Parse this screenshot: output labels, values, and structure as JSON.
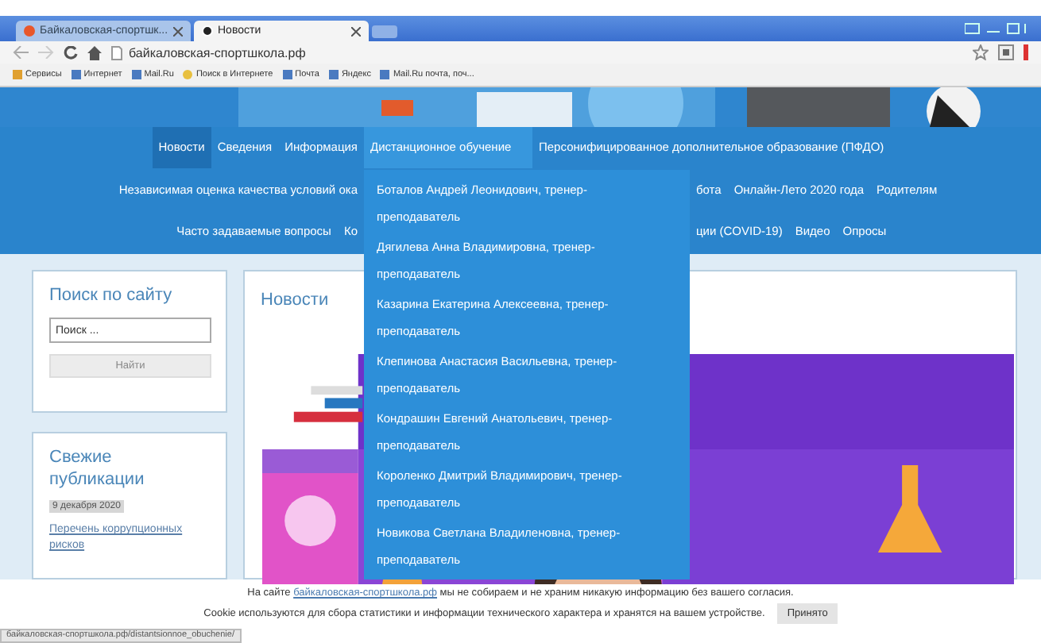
{
  "browser": {
    "tabs": [
      {
        "title": "Байкаловская-спортшк...",
        "selected": false
      },
      {
        "title": "Новости",
        "selected": true
      }
    ],
    "address": "байкаловская-спортшкола.рф",
    "bookmarks": [
      "Сервисы",
      "Интернет",
      "Mail.Ru",
      "Поиск в Интернете",
      "Почта",
      "Яндекс",
      "Mail.Ru почта, поч..."
    ]
  },
  "nav": {
    "rows": [
      {
        "left": [
          {
            "label": "Новости",
            "selected": true
          },
          {
            "label": "Сведения",
            "selected": false
          },
          {
            "label": "Информация",
            "selected": false
          }
        ],
        "right": [
          {
            "label": "Дистанционное обучение",
            "selected": false,
            "expanded": true
          },
          {
            "label": "Персонифицированное дополнительное образование (ПФДО)",
            "selected": false,
            "expanded": false
          }
        ]
      },
      {
        "left": [
          {
            "label": "Независимая оценка качества условий ока",
            "selected": false
          }
        ],
        "right": [
          {
            "label": "бота",
            "selected": false
          },
          {
            "label": "Онлайн-Лето 2020 года",
            "selected": false
          },
          {
            "label": "Родителям",
            "selected": false
          }
        ]
      },
      {
        "left": [
          {
            "label": "Часто задаваемые вопросы",
            "selected": false
          },
          {
            "label": "Ко",
            "selected": false
          }
        ],
        "right": [
          {
            "label": "ции (COVID-19)",
            "selected": false
          },
          {
            "label": "Видео",
            "selected": false
          },
          {
            "label": "Опросы",
            "selected": false
          }
        ]
      }
    ],
    "dropdown": [
      "Боталов Андрей Леонидович, тренер-преподаватель",
      "Дягилева Анна Владимировна, тренер-преподаватель",
      "Казарина Екатерина Алексеевна, тренер-преподаватель",
      "Клепинова Анастасия Васильевна, тренер-преподаватель",
      "Кондрашин Евгений Анатольевич, тренер-преподаватель",
      "Короленко Дмитрий Владимирович, тренер-преподаватель",
      "Новикова Светлана Владиленовна, тренер-преподаватель"
    ]
  },
  "search": {
    "title": "Поиск по сайту",
    "placeholder": "Поиск ...",
    "button": "Найти"
  },
  "recent": {
    "title": "Свежие публикации",
    "date": "9 декабря 2020",
    "link": "Перечень коррупционных рисков"
  },
  "news": {
    "title": "Новости"
  },
  "cookie": {
    "line1_before": "На сайте",
    "line1_link": "байкаловская-спортшкола.рф",
    "line1_after": "мы не собираем и не храним никакую информацию без вашего согласия.",
    "line2": "Cookie используются для сбора статистики и информации технического характера и хранятся на вашем устройстве.",
    "button": "Принято"
  },
  "status_bar": "байкаловская-спортшкола.рф/distantsionnoe_obuchenie/"
}
